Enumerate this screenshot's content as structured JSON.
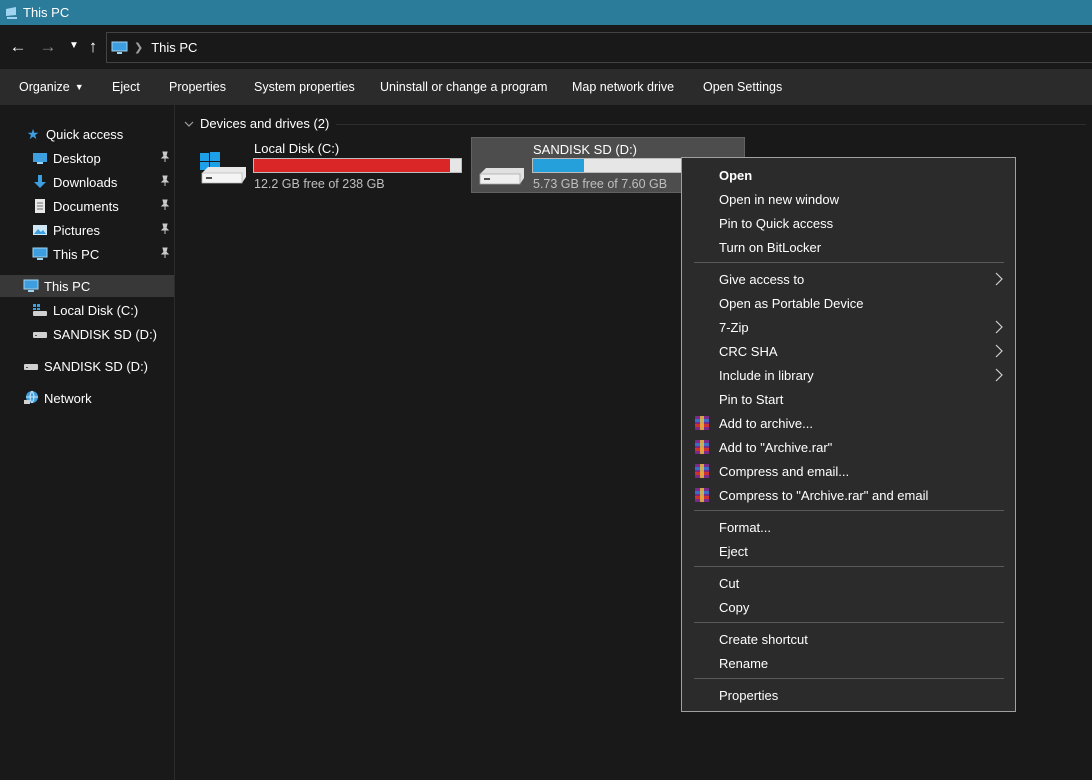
{
  "window": {
    "title": "This PC"
  },
  "address": {
    "location": "This PC"
  },
  "toolbar": {
    "organize": "Organize",
    "eject": "Eject",
    "properties": "Properties",
    "system_properties": "System properties",
    "uninstall": "Uninstall or change a program",
    "map_drive": "Map network drive",
    "open_settings": "Open Settings"
  },
  "sidebar": {
    "quick_access": "Quick access",
    "qa_items": [
      "Desktop",
      "Downloads",
      "Documents",
      "Pictures",
      "This PC"
    ],
    "this_pc": "This PC",
    "pc_items": [
      "Local Disk (C:)",
      "SANDISK SD (D:)"
    ],
    "sandisk": "SANDISK SD (D:)",
    "network": "Network"
  },
  "main": {
    "group_header": "Devices and drives (2)",
    "drives": [
      {
        "name": "Local Disk (C:)",
        "free_text": "12.2 GB free of 238 GB",
        "used_fraction": 0.949,
        "bar_color": "#da2626"
      },
      {
        "name": "SANDISK SD (D:)",
        "free_text": "5.73 GB free of 7.60 GB",
        "used_fraction": 0.246,
        "bar_color": "#26a0da"
      }
    ]
  },
  "context_menu": {
    "items": [
      "Open",
      "Open in new window",
      "Pin to Quick access",
      "Turn on BitLocker",
      "Give access to",
      "Open as Portable Device",
      "7-Zip",
      "CRC SHA",
      "Include in library",
      "Pin to Start",
      "Add to archive...",
      "Add to \"Archive.rar\"",
      "Compress and email...",
      "Compress to \"Archive.rar\" and email",
      "Format...",
      "Eject",
      "Cut",
      "Copy",
      "Create shortcut",
      "Rename",
      "Properties"
    ]
  },
  "colors": {
    "titlebar": "#2b7b9a",
    "accent": "#26a0da",
    "danger": "#da2626"
  }
}
